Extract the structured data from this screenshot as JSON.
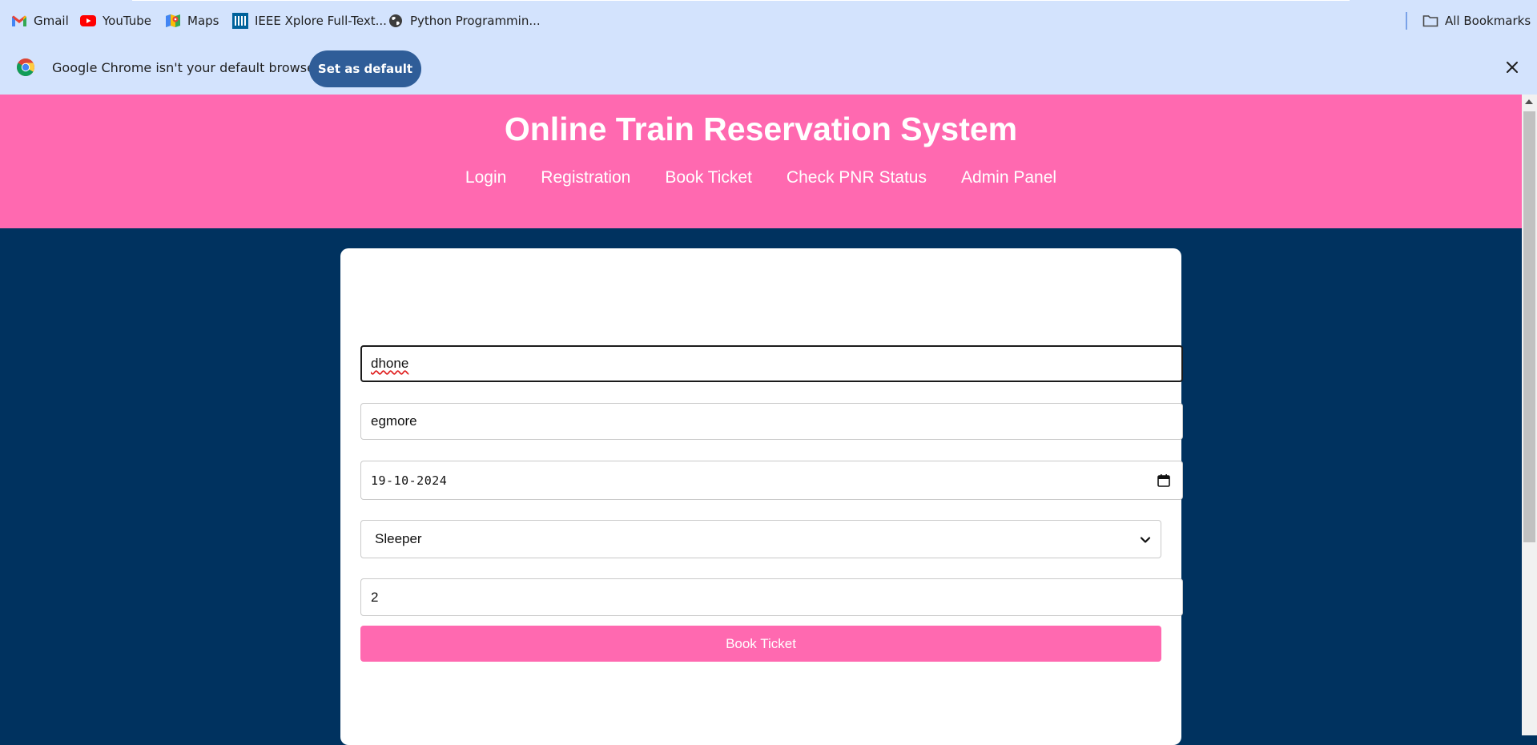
{
  "bookmarks": {
    "items": [
      {
        "label": "Gmail",
        "icon": "gmail-icon"
      },
      {
        "label": "YouTube",
        "icon": "youtube-icon"
      },
      {
        "label": "Maps",
        "icon": "maps-icon"
      },
      {
        "label": "IEEE Xplore Full-Text...",
        "icon": "ieee-icon"
      },
      {
        "label": "Python Programmin...",
        "icon": "globe-icon"
      }
    ],
    "all_bookmarks": "All Bookmarks"
  },
  "infobar": {
    "message": "Google Chrome isn't your default browser",
    "set_default_label": "Set as default"
  },
  "site": {
    "title": "Online Train Reservation System",
    "nav": [
      "Login",
      "Registration",
      "Book Ticket",
      "Check PNR Status",
      "Admin Panel"
    ]
  },
  "form": {
    "from_value": "dhone",
    "to_value": "egmore",
    "date_value": "19-10-2024",
    "class_value": "Sleeper",
    "passengers_value": "2",
    "submit_label": "Book Ticket"
  },
  "colors": {
    "header_pink": "#ff69b0",
    "page_navy": "#00325f",
    "chrome_bar": "#d3e3fd",
    "button_blue": "#2f5d98"
  }
}
